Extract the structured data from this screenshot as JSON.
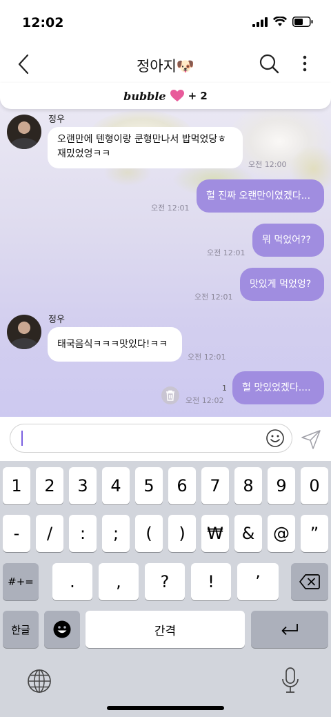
{
  "status": {
    "time": "12:02"
  },
  "header": {
    "title": "정아지🐶"
  },
  "banner": {
    "logo": "bubble",
    "heart": "♥",
    "count": "+ 2"
  },
  "messages": [
    {
      "sender": "정우",
      "text_line1": "오랜만에 텐형이랑 쿤형만나서 밥먹었당ㅎ",
      "text_line2": "재밌었엉ㅋㅋ",
      "time": "오전 12:00"
    },
    {
      "text": "헐 진짜 오랜만이였겠다...",
      "time": "오전 12:01"
    },
    {
      "text": "뭐 먹었어??",
      "time": "오전 12:01"
    },
    {
      "text": "맛있게 먹었엉?",
      "time": "오전 12:01"
    },
    {
      "sender": "정우",
      "text": "태국음식ㅋㅋㅋ맛있다!ㅋㅋ",
      "time": "오전 12:01"
    },
    {
      "text": "헐 맛있었겠다....",
      "time": "오전 12:02",
      "unread": "1"
    }
  ],
  "input": {
    "value": ""
  },
  "keyboard": {
    "row1": [
      "1",
      "2",
      "3",
      "4",
      "5",
      "6",
      "7",
      "8",
      "9",
      "0"
    ],
    "row2": [
      "-",
      "/",
      ":",
      ";",
      "(",
      ")",
      "₩",
      "&",
      "@",
      "”"
    ],
    "symbols_key": "#+=",
    "row3": [
      ".",
      ",",
      "?",
      "!",
      "’"
    ],
    "lang_key": "한글",
    "space_key": "간격",
    "return_icon": "return-arrow",
    "backspace_icon": "backspace"
  },
  "colors": {
    "sent_bubble": "#a08de0",
    "accent": "#7a5fe0",
    "heart": "#e85a9a"
  },
  "icons": [
    "back-chevron-icon",
    "search-icon",
    "more-icon",
    "emoji-icon",
    "send-icon",
    "trash-icon",
    "globe-icon",
    "mic-icon"
  ]
}
